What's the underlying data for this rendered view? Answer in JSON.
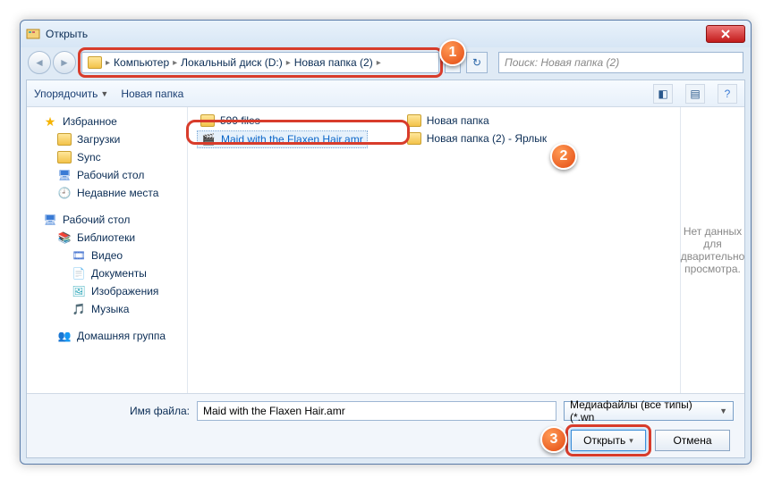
{
  "window": {
    "title": "Открыть"
  },
  "breadcrumb": {
    "items": [
      "Компьютер",
      "Локальный диск (D:)",
      "Новая папка (2)"
    ]
  },
  "search": {
    "placeholder": "Поиск: Новая папка (2)"
  },
  "toolbar": {
    "organize": "Упорядочить",
    "new_folder": "Новая папка"
  },
  "sidebar": {
    "favorites": "Избранное",
    "downloads": "Загрузки",
    "sync": "Sync",
    "desktop": "Рабочий стол",
    "recent": "Недавние места",
    "desktop2": "Рабочий стол",
    "libraries": "Библиотеки",
    "video": "Видео",
    "documents": "Документы",
    "pictures": "Изображения",
    "music": "Музыка",
    "homegroup": "Домашняя группа"
  },
  "files": {
    "col1": {
      "a": "599 files",
      "b": "Maid with the Flaxen Hair.amr"
    },
    "col2": {
      "a": "Новая папка",
      "b": "Новая папка (2) - Ярлык"
    }
  },
  "preview": {
    "text": "Нет данных для дварительно просмотра."
  },
  "footer": {
    "filename_label": "Имя файла:",
    "filename_value": "Maid with the Flaxen Hair.amr",
    "filter": "Медиафайлы (все типы) (*.wn",
    "open": "Открыть",
    "cancel": "Отмена"
  },
  "badges": {
    "b1": "1",
    "b2": "2",
    "b3": "3"
  }
}
